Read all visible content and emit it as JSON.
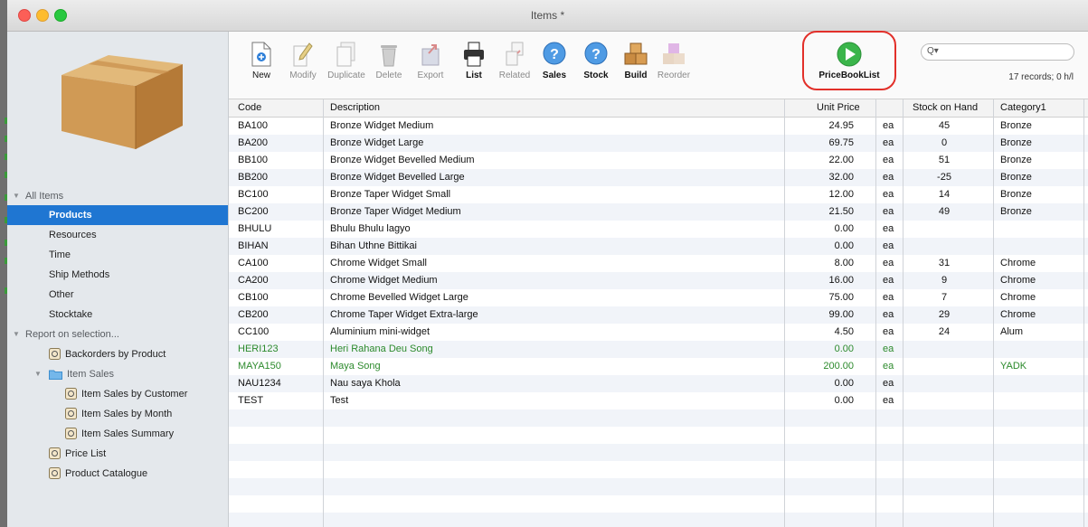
{
  "window": {
    "title": "Items *"
  },
  "sidebar": {
    "all_items": "All Items",
    "items": [
      "Products",
      "Resources",
      "Time",
      "Ship Methods",
      "Other",
      "Stocktake"
    ],
    "selected": "Products",
    "report_header": "Report on selection...",
    "reports": {
      "backorders": "Backorders by Product",
      "item_sales": "Item Sales",
      "item_sales_by_customer": "Item Sales by Customer",
      "item_sales_by_month": "Item Sales by Month",
      "item_sales_summary": "Item Sales Summary",
      "price_list": "Price List",
      "product_catalogue": "Product Catalogue"
    }
  },
  "toolbar": {
    "new": "New",
    "modify": "Modify",
    "duplicate": "Duplicate",
    "delete": "Delete",
    "export": "Export",
    "list": "List",
    "related": "Related",
    "sales": "Sales",
    "stock": "Stock",
    "build": "Build",
    "reorder": "Reorder",
    "pricebooklist": "PriceBookList",
    "search_placeholder": "",
    "records": "17 records; 0 h/l"
  },
  "table": {
    "columns": {
      "code": "Code",
      "description": "Description",
      "unit_price": "Unit Price",
      "stock": "Stock on Hand",
      "category": "Category1"
    },
    "rows": [
      {
        "code": "BA100",
        "desc": "Bronze Widget Medium",
        "price": "24.95",
        "unit": "ea",
        "stock": "45",
        "cat": "Bronze"
      },
      {
        "code": "BA200",
        "desc": "Bronze Widget Large",
        "price": "69.75",
        "unit": "ea",
        "stock": "0",
        "cat": "Bronze"
      },
      {
        "code": "BB100",
        "desc": "Bronze Widget Bevelled Medium",
        "price": "22.00",
        "unit": "ea",
        "stock": "51",
        "cat": "Bronze"
      },
      {
        "code": "BB200",
        "desc": "Bronze Widget Bevelled Large",
        "price": "32.00",
        "unit": "ea",
        "stock": "-25",
        "cat": "Bronze"
      },
      {
        "code": "BC100",
        "desc": "Bronze Taper Widget Small",
        "price": "12.00",
        "unit": "ea",
        "stock": "14",
        "cat": "Bronze"
      },
      {
        "code": "BC200",
        "desc": "Bronze Taper Widget Medium",
        "price": "21.50",
        "unit": "ea",
        "stock": "49",
        "cat": "Bronze"
      },
      {
        "code": "BHULU",
        "desc": "Bhulu Bhulu lagyo",
        "price": "0.00",
        "unit": "ea",
        "stock": "",
        "cat": ""
      },
      {
        "code": "BIHAN",
        "desc": "Bihan Uthne Bittikai",
        "price": "0.00",
        "unit": "ea",
        "stock": "",
        "cat": ""
      },
      {
        "code": "CA100",
        "desc": "Chrome Widget Small",
        "price": "8.00",
        "unit": "ea",
        "stock": "31",
        "cat": "Chrome"
      },
      {
        "code": "CA200",
        "desc": "Chrome Widget Medium",
        "price": "16.00",
        "unit": "ea",
        "stock": "9",
        "cat": "Chrome"
      },
      {
        "code": "CB100",
        "desc": "Chrome Bevelled Widget Large",
        "price": "75.00",
        "unit": "ea",
        "stock": "7",
        "cat": "Chrome"
      },
      {
        "code": "CB200",
        "desc": "Chrome Taper Widget Extra-large",
        "price": "99.00",
        "unit": "ea",
        "stock": "29",
        "cat": "Chrome"
      },
      {
        "code": "CC100",
        "desc": "Aluminium mini-widget",
        "price": "4.50",
        "unit": "ea",
        "stock": "24",
        "cat": "Alum"
      },
      {
        "code": "HERI123",
        "desc": "Heri Rahana Deu Song",
        "price": "0.00",
        "unit": "ea",
        "stock": "",
        "cat": "",
        "green": true
      },
      {
        "code": "MAYA150",
        "desc": "Maya Song",
        "price": "200.00",
        "unit": "ea",
        "stock": "",
        "cat": "YADK",
        "green": true
      },
      {
        "code": "NAU1234",
        "desc": "Nau saya Khola",
        "price": "0.00",
        "unit": "ea",
        "stock": "",
        "cat": ""
      },
      {
        "code": "TEST",
        "desc": "Test",
        "price": "0.00",
        "unit": "ea",
        "stock": "",
        "cat": ""
      }
    ]
  },
  "colors": {
    "selection": "#1f76d2",
    "highlight": "#e2302a",
    "inactive_green": "#2c8a2c"
  }
}
